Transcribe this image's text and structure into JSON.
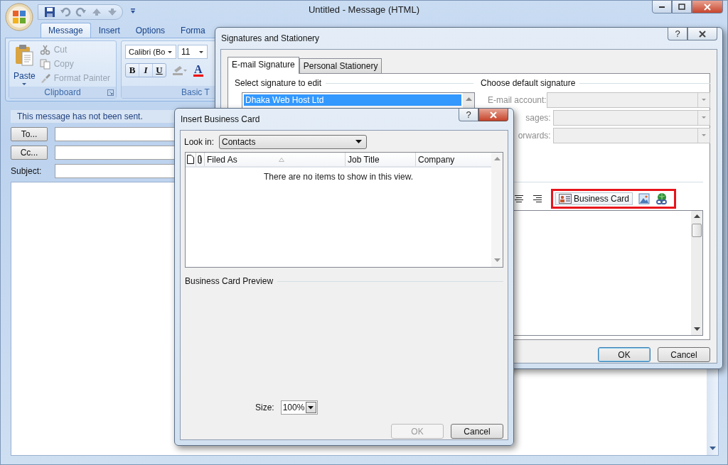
{
  "main_window": {
    "title": "Untitled - Message (HTML)",
    "tabs": [
      {
        "label": "Message",
        "selected": true
      },
      {
        "label": "Insert",
        "selected": false
      },
      {
        "label": "Options",
        "selected": false
      },
      {
        "label": "Forma",
        "selected": false
      }
    ],
    "clipboard": {
      "paste": "Paste",
      "commands": [
        {
          "label": "Cut",
          "disabled": true
        },
        {
          "label": "Copy",
          "disabled": true
        },
        {
          "label": "Format Painter",
          "disabled": true
        }
      ],
      "group_label": "Clipboard"
    },
    "basic_text": {
      "font": "Calibri (Bo",
      "size": "11",
      "styles": [
        "B",
        "I",
        "U"
      ],
      "font_color": "A",
      "group_label": "Basic T"
    },
    "info_bar": "This message has not been sent.",
    "recipients": [
      {
        "button": "To..."
      },
      {
        "button": "Cc..."
      }
    ],
    "subject_label": "Subject:"
  },
  "signatures_dialog": {
    "title": "Signatures and Stationery",
    "help": "?",
    "tabs": [
      {
        "label": "E-mail Signature",
        "selected": true
      },
      {
        "label": "Personal Stationery",
        "selected": false
      }
    ],
    "select_heading": "Select signature to edit",
    "signatures": [
      {
        "name": "Dhaka Web Host Ltd",
        "selected": true
      }
    ],
    "default_heading": "Choose default signature",
    "default_fields": [
      {
        "label": "E-mail account:",
        "disabled": true
      },
      {
        "label": "sages:",
        "disabled": true
      },
      {
        "label": "orwards:",
        "disabled": true
      }
    ],
    "insert_button": "Business Card",
    "buttons": [
      {
        "label": "OK",
        "default": true
      },
      {
        "label": "Cancel",
        "default": false
      }
    ]
  },
  "insert_dialog": {
    "title": "Insert Business Card",
    "help": "?",
    "look_in_label": "Look in:",
    "look_in": "Contacts",
    "columns": [
      "Filed As",
      "Job Title",
      "Company"
    ],
    "empty_message": "There are no items to show in this view.",
    "preview_label": "Business Card Preview",
    "size_label": "Size:",
    "size": "100%",
    "buttons": [
      {
        "label": "OK",
        "disabled": true
      },
      {
        "label": "Cancel",
        "disabled": false
      }
    ]
  }
}
